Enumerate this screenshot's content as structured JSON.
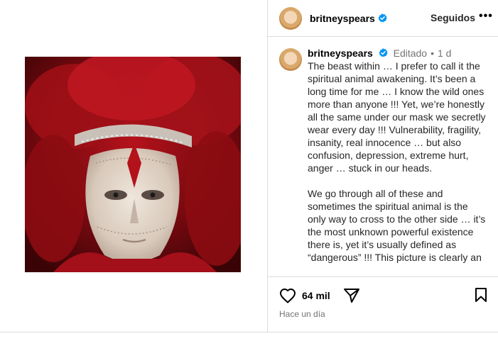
{
  "post": {
    "author": "britneyspears",
    "follow_label": "Seguidos",
    "more_label": "•••",
    "caption": {
      "author": "britneyspears",
      "edited_label": "Editado",
      "separator": "•",
      "time": "1 d",
      "paragraph1": "The beast within … I prefer to call it the spiritual animal awakening. It’s been a long time for me … I know the wild ones more than anyone !!! Yet, we’re honestly all the same under our mask we secretly wear every day !!! Vulnerability, fragility, insanity, real innocence … but also confusion, depression, extreme hurt, anger … stuck in our heads.",
      "paragraph2": "We go through all of these and sometimes the spiritual animal is the only way to cross to the other side … it’s the most unknown powerful existence there is, yet it’s usually defined as “dangerous” !!! This picture is clearly an"
    },
    "likes": "64 mil",
    "posted_ago": "Hace un día"
  },
  "icons": {
    "verified": "verified-badge-icon",
    "like": "heart-icon",
    "share": "share-icon",
    "save": "bookmark-icon"
  },
  "colors": {
    "verified_blue": "#0095f6",
    "border": "#dbdbdb",
    "secondary_text": "#737373"
  }
}
